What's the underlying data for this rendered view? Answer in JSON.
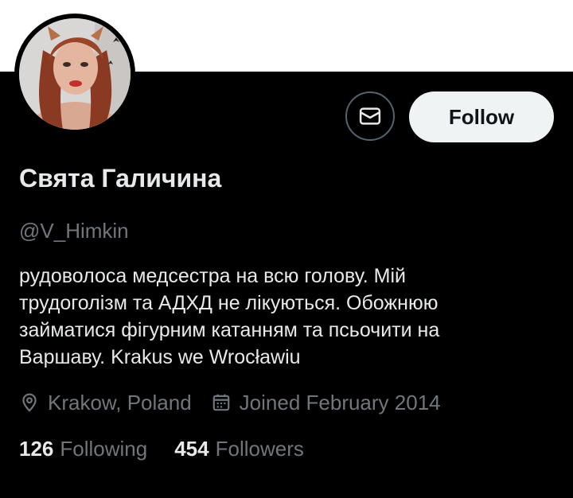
{
  "profile": {
    "display_name": "Свята Галичина",
    "handle": "@V_Himkin",
    "bio_lines": [
      "рудоволоса медсестра на всю голову. Мій",
      "трудоголізм та АДХД не лікуються. Обожнюю",
      "займатися фігурним катанням та псьочити на",
      "Варшаву. Krakus we Wrocławiu"
    ],
    "location": "Krakow, Poland",
    "joined": "Joined February 2014"
  },
  "actions": {
    "follow_label": "Follow",
    "message_icon": "envelope-icon"
  },
  "stats": {
    "following_count": "126",
    "following_label": "Following",
    "followers_count": "454",
    "followers_label": "Followers"
  },
  "icons": {
    "location": "map-pin-icon",
    "joined": "calendar-icon"
  },
  "colors": {
    "background": "#000000",
    "banner": "#ffffff",
    "primary_text": "#e7e9ea",
    "secondary_text": "#71767b",
    "follow_button_bg": "#eff3f4",
    "follow_button_text": "#0f1419",
    "message_button_border": "#536471"
  }
}
